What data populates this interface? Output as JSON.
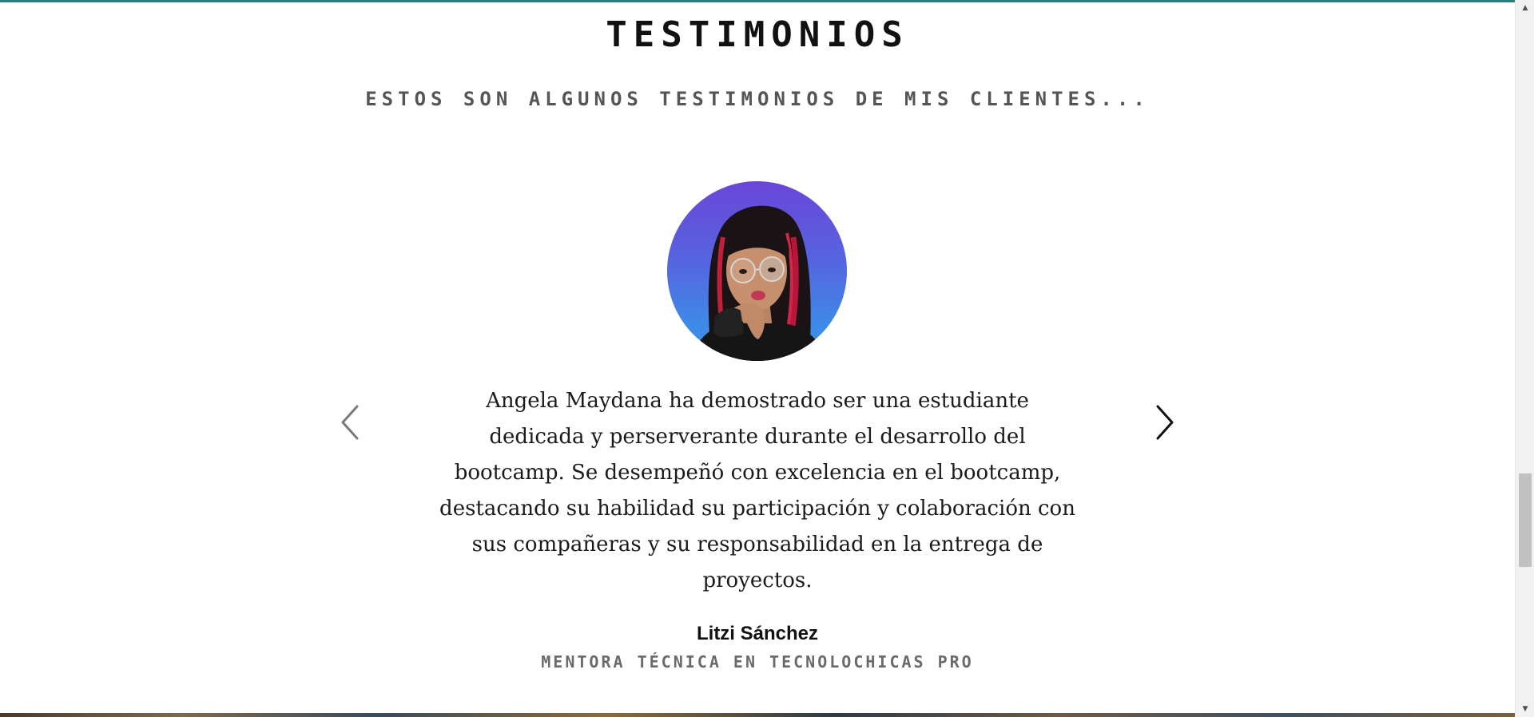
{
  "section": {
    "title": "TESTIMONIOS",
    "subtitle": "ESTOS SON ALGUNOS TESTIMONIOS DE MIS CLIENTES..."
  },
  "testimonial": {
    "avatar_icon": "person-photo",
    "quote_lines": [
      "Angela Maydana ha demostrado ser una estudiante",
      "dedicada y perserverante durante el desarrollo del",
      "bootcamp. Se desempeñó con excelencia en el bootcamp,",
      "destacando su habilidad su participación y colaboración con",
      "sus compañeras y su responsabilidad en la entrega de",
      "proyectos."
    ],
    "author_name": "Litzi Sánchez",
    "author_role": "MENTORA TÉCNICA EN TECNOLOCHICAS PRO"
  },
  "carousel": {
    "prev_icon": "chevron-left-icon",
    "next_icon": "chevron-right-icon"
  },
  "scrollbar": {
    "up_icon": "▲",
    "down_icon": "▼"
  },
  "colors": {
    "accent": "#2f7c7c",
    "avatar_gradient_top": "#6a46d8",
    "avatar_gradient_bottom": "#3a93e6",
    "text": "#1b1b1b",
    "muted": "#555555"
  }
}
